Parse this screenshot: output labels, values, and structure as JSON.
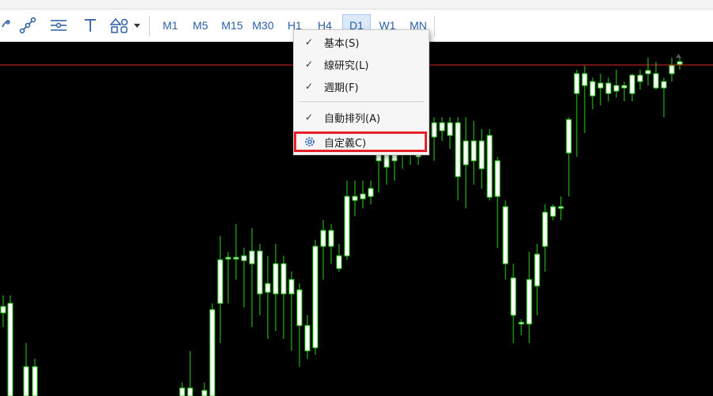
{
  "toolbar": {
    "tools": [
      {
        "icon": "line-tool-icon"
      },
      {
        "icon": "trendline-tool-icon"
      },
      {
        "icon": "channel-tool-icon"
      },
      {
        "icon": "text-tool-icon"
      },
      {
        "icon": "shapes-tool-icon"
      }
    ],
    "timeframes": [
      {
        "label": "M1",
        "active": false
      },
      {
        "label": "M5",
        "active": false
      },
      {
        "label": "M15",
        "active": false
      },
      {
        "label": "M30",
        "active": false
      },
      {
        "label": "H1",
        "active": false
      },
      {
        "label": "H4",
        "active": false
      },
      {
        "label": "D1",
        "active": true
      },
      {
        "label": "W1",
        "active": false
      },
      {
        "label": "MN",
        "active": false
      }
    ]
  },
  "context_menu": {
    "items": [
      {
        "label": "基本(S)",
        "checked": true
      },
      {
        "label": "線研究(L)",
        "checked": true
      },
      {
        "label": "週期(F)",
        "checked": true
      },
      {
        "label": "自動排列(A)",
        "checked": true
      },
      {
        "label": "自定義C)",
        "checked": false,
        "icon": "gear-icon",
        "highlighted": true
      }
    ]
  },
  "colors": {
    "chart_background": "#000000",
    "candle": "#2cd31c",
    "candle_body_up": "#ffffff",
    "price_line": "#e8202a",
    "highlight": "#e8202a",
    "accent": "#2b5fa8"
  }
}
